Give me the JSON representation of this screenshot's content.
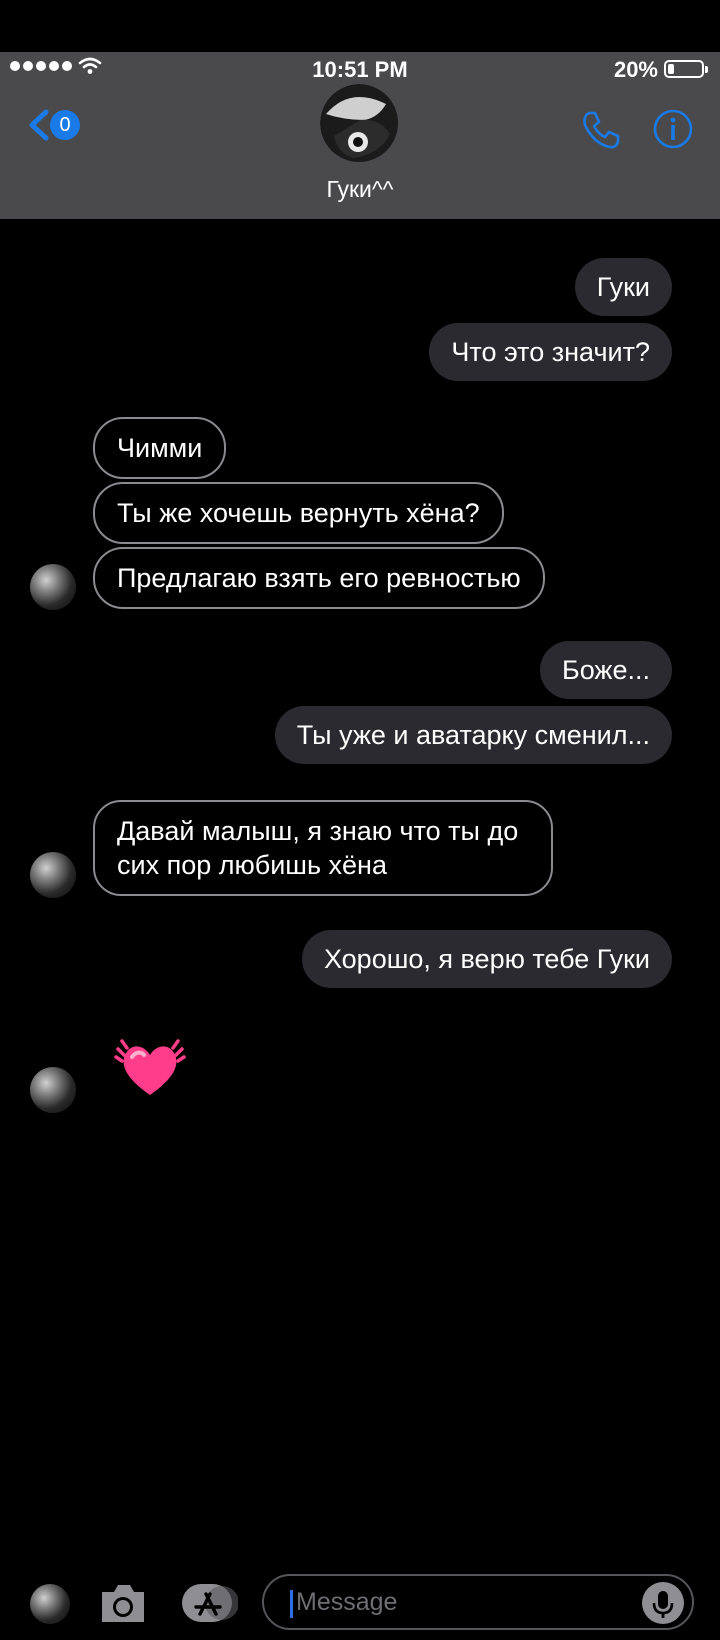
{
  "status_bar": {
    "time": "10:51 PM",
    "battery": "20%",
    "battery_level": 0.2
  },
  "header": {
    "back_badge": "0",
    "contact_name": "Гуки^^",
    "phone_icon": "phone-icon",
    "info_icon": "info-icon"
  },
  "messages": [
    {
      "side": "out",
      "text": "Гуки"
    },
    {
      "side": "out",
      "text": "Что это значит?"
    },
    {
      "side": "in",
      "text": "Чимми"
    },
    {
      "side": "in",
      "text": "Ты же хочешь вернуть хёна?"
    },
    {
      "side": "in",
      "text": "Предлагаю взять его ревностью"
    },
    {
      "side": "out",
      "text": "Боже..."
    },
    {
      "side": "out",
      "text": "Ты уже и аватарку сменил..."
    },
    {
      "side": "in",
      "text": "Давай малыш, я знаю что ты до сих пор любишь хёна"
    },
    {
      "side": "out",
      "text": "Хорошо, я верю тебе Гуки"
    },
    {
      "side": "in",
      "text": "",
      "emoji": "beating-heart"
    }
  ],
  "input": {
    "placeholder": "Message"
  },
  "colors": {
    "accent": "#1a7ae8",
    "header_bg": "#4a4a4d",
    "outgoing_bg": "#2b2a30"
  }
}
